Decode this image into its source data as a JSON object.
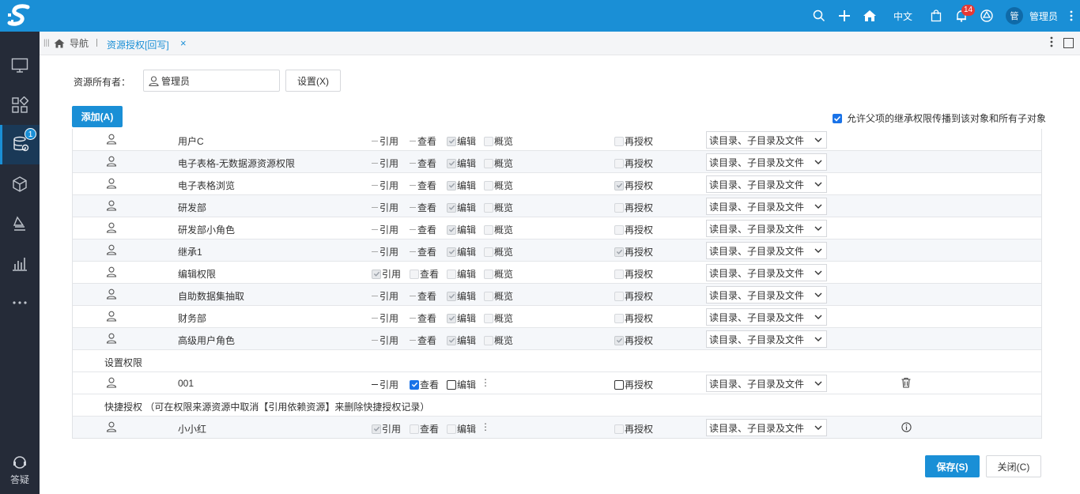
{
  "topbar": {
    "lang": "中文",
    "notification_count": "14",
    "avatar_text": "管",
    "username": "管理员"
  },
  "sidebar": {
    "active_badge": "1",
    "help_label": "答疑"
  },
  "tabs": {
    "home_label": "导航",
    "active_label": "资源授权[回写]",
    "close_glyph": "×"
  },
  "owner": {
    "label": "资源所有者：",
    "value": "管理员",
    "set_button": "设置(X)"
  },
  "add_button": "添加(A)",
  "inherit_checkbox_label": "允许父项的继承权限传播到该对象和所有子对象",
  "perm_labels": {
    "ref": "引用",
    "view": "查看",
    "edit": "编辑",
    "browse": "概览",
    "regrant": "再授权"
  },
  "scope_option": "读目录、子目录及文件",
  "inherited_rows": [
    {
      "name": "用户C",
      "regrant_checked": false
    },
    {
      "name": "电子表格-无数据源资源权限",
      "regrant_checked": false
    },
    {
      "name": "电子表格浏览",
      "regrant_checked": true
    },
    {
      "name": "研发部",
      "regrant_checked": false
    },
    {
      "name": "研发部小角色",
      "regrant_checked": false
    },
    {
      "name": "继承1",
      "regrant_checked": true
    },
    {
      "name": "编辑权限",
      "regrant_checked": false
    },
    {
      "name": "自助数据集抽取",
      "regrant_checked": false
    },
    {
      "name": "财务部",
      "regrant_checked": false
    },
    {
      "name": "高级用户角色",
      "regrant_checked": true
    }
  ],
  "section_set": "设置权限",
  "set_row": {
    "name": "001"
  },
  "section_quick": "快捷授权 （可在权限来源资源中取消【引用依赖资源】来删除快捷授权记录）",
  "quick_row": {
    "name": "小小红"
  },
  "footer": {
    "save": "保存(S)",
    "close": "关闭(C)"
  }
}
